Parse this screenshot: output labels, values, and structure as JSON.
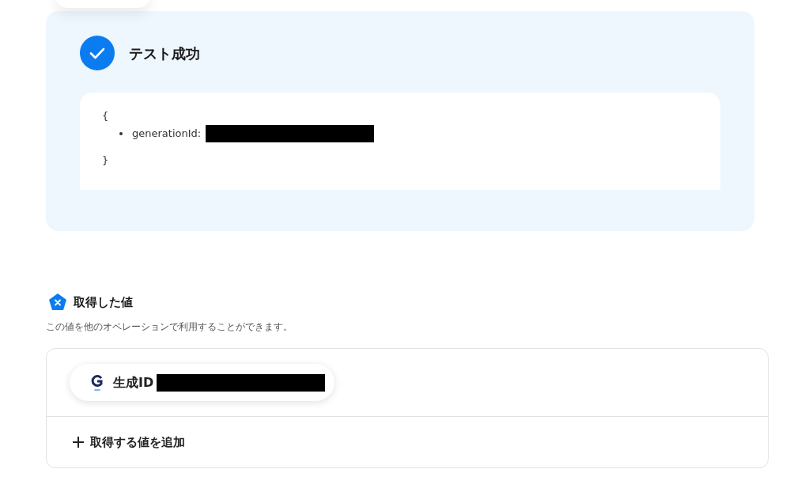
{
  "result": {
    "title": "テスト成功",
    "open_brace": "{",
    "fields": [
      {
        "key": "generationId:",
        "redacted": true
      }
    ],
    "close_brace": "}"
  },
  "values": {
    "title": "取得した値",
    "description": "この値を他のオペレーションで利用することができます。",
    "items": [
      {
        "label": "生成ID",
        "redacted": true
      }
    ],
    "add_label": "取得する値を追加"
  }
}
